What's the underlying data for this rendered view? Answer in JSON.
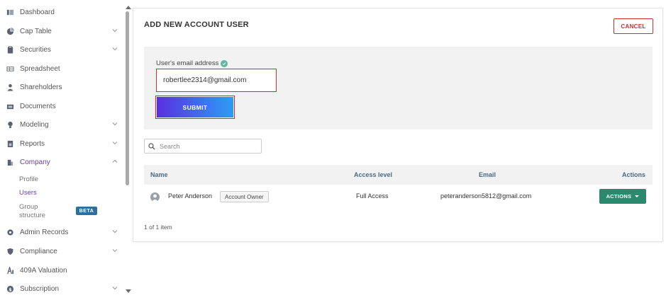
{
  "sidebar": {
    "items": [
      {
        "label": "Dashboard",
        "icon": "dashboard-icon",
        "expandable": false,
        "active": false
      },
      {
        "label": "Cap Table",
        "icon": "pie-chart-icon",
        "expandable": true,
        "active": false
      },
      {
        "label": "Securities",
        "icon": "clipboard-icon",
        "expandable": true,
        "active": false
      },
      {
        "label": "Spreadsheet",
        "icon": "spreadsheet-icon",
        "expandable": false,
        "active": false
      },
      {
        "label": "Shareholders",
        "icon": "person-icon",
        "expandable": false,
        "active": false
      },
      {
        "label": "Documents",
        "icon": "folder-icon",
        "expandable": false,
        "active": false
      },
      {
        "label": "Modeling",
        "icon": "lightbulb-icon",
        "expandable": true,
        "active": false
      },
      {
        "label": "Reports",
        "icon": "report-icon",
        "expandable": true,
        "active": false
      },
      {
        "label": "Company",
        "icon": "building-icon",
        "expandable": true,
        "active": true
      },
      {
        "label": "Admin Records",
        "icon": "gear-icon",
        "expandable": true,
        "active": false
      },
      {
        "label": "Compliance",
        "icon": "shield-icon",
        "expandable": true,
        "active": false
      },
      {
        "label": "409A Valuation",
        "icon": "valuation-icon",
        "expandable": false,
        "active": false
      },
      {
        "label": "Subscription",
        "icon": "dollar-icon",
        "expandable": true,
        "active": false
      }
    ],
    "company_sub": {
      "profile": "Profile",
      "users": "Users",
      "group_line1": "Group",
      "group_line2": "structure",
      "beta": "BETA"
    }
  },
  "card": {
    "title": "ADD NEW ACCOUNT USER",
    "cancel_label": "CANCEL"
  },
  "form": {
    "email_label": "User's email address",
    "email_value": "robertlee2314@gmail.com",
    "submit_label": "SUBMIT"
  },
  "search": {
    "placeholder": "Search"
  },
  "table": {
    "columns": {
      "name": "Name",
      "access": "Access level",
      "email": "Email",
      "actions": "Actions"
    },
    "rows": [
      {
        "name": "Peter Anderson",
        "badge": "Account Owner",
        "access": "Full Access",
        "email": "peteranderson5812@gmail.com",
        "action_label": "ACTIONS"
      }
    ],
    "pagination": "1 of 1 item"
  },
  "colors": {
    "accent_purple": "#6b3fa0",
    "cancel_red": "#c9302c",
    "highlight_red": "#d62b2b",
    "actions_green": "#2b8a6e",
    "header_text": "#4a6b86"
  }
}
